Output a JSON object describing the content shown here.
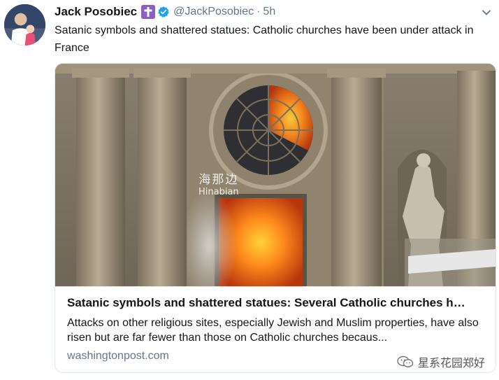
{
  "author": {
    "display_name": "Jack Posobiec",
    "handle": "@JackPosobiec",
    "separator": "·",
    "timestamp": "5h",
    "verified": true,
    "badge_icon": "latin-cross-icon",
    "badge_color": "#8e5ec2",
    "verified_color": "#1da1f2"
  },
  "tweet": {
    "text": "Satanic symbols and shattered statues: Catholic churches have been under attack in France"
  },
  "card": {
    "image_watermark_cn": "海那边",
    "image_watermark_en": "Hinabian",
    "title": "Satanic symbols and shattered statues: Several Catholic churches h…",
    "description": "Attacks on other religious sites, especially Jewish and Muslim properties, have also risen but are far fewer than those on Catholic churches becaus...",
    "domain": "washingtonpost.com"
  },
  "footer_watermark": {
    "text": "星系花园郑好",
    "icon": "wechat-icon"
  },
  "colors": {
    "text_primary": "#14171a",
    "text_secondary": "#657786",
    "border": "#e1e8ed"
  }
}
